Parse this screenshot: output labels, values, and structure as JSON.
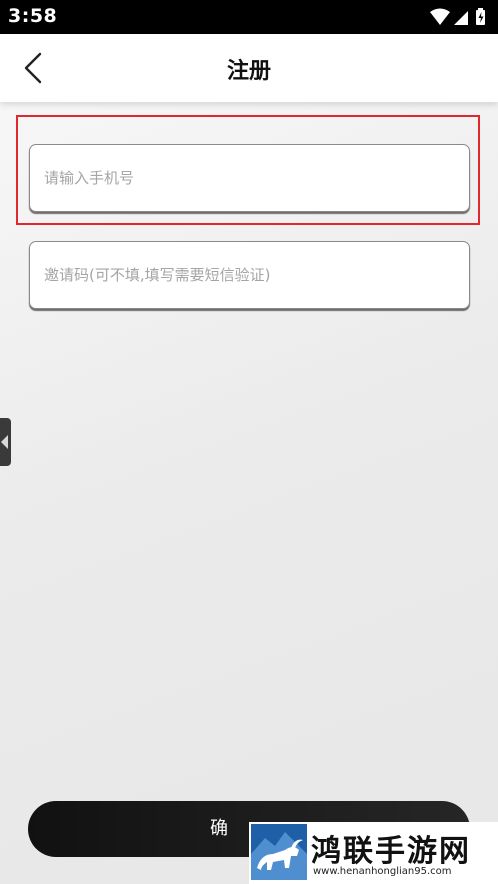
{
  "status_bar": {
    "time": "3:58",
    "icons": [
      "wifi-icon",
      "signal-icon",
      "battery-charging-icon"
    ]
  },
  "header": {
    "back_icon": "chevron-left-icon",
    "title": "注册"
  },
  "form": {
    "phone": {
      "value": "",
      "placeholder": "请输入手机号"
    },
    "invite_code": {
      "value": "",
      "placeholder": "邀请码(可不填,填写需要短信验证)"
    },
    "highlight_color": "#e0282e"
  },
  "confirm_button": {
    "label": "确"
  },
  "watermark": {
    "name": "鸿联手游网",
    "url": "www.henanhonglian95.com",
    "brand_color": "#1f5fa8"
  }
}
